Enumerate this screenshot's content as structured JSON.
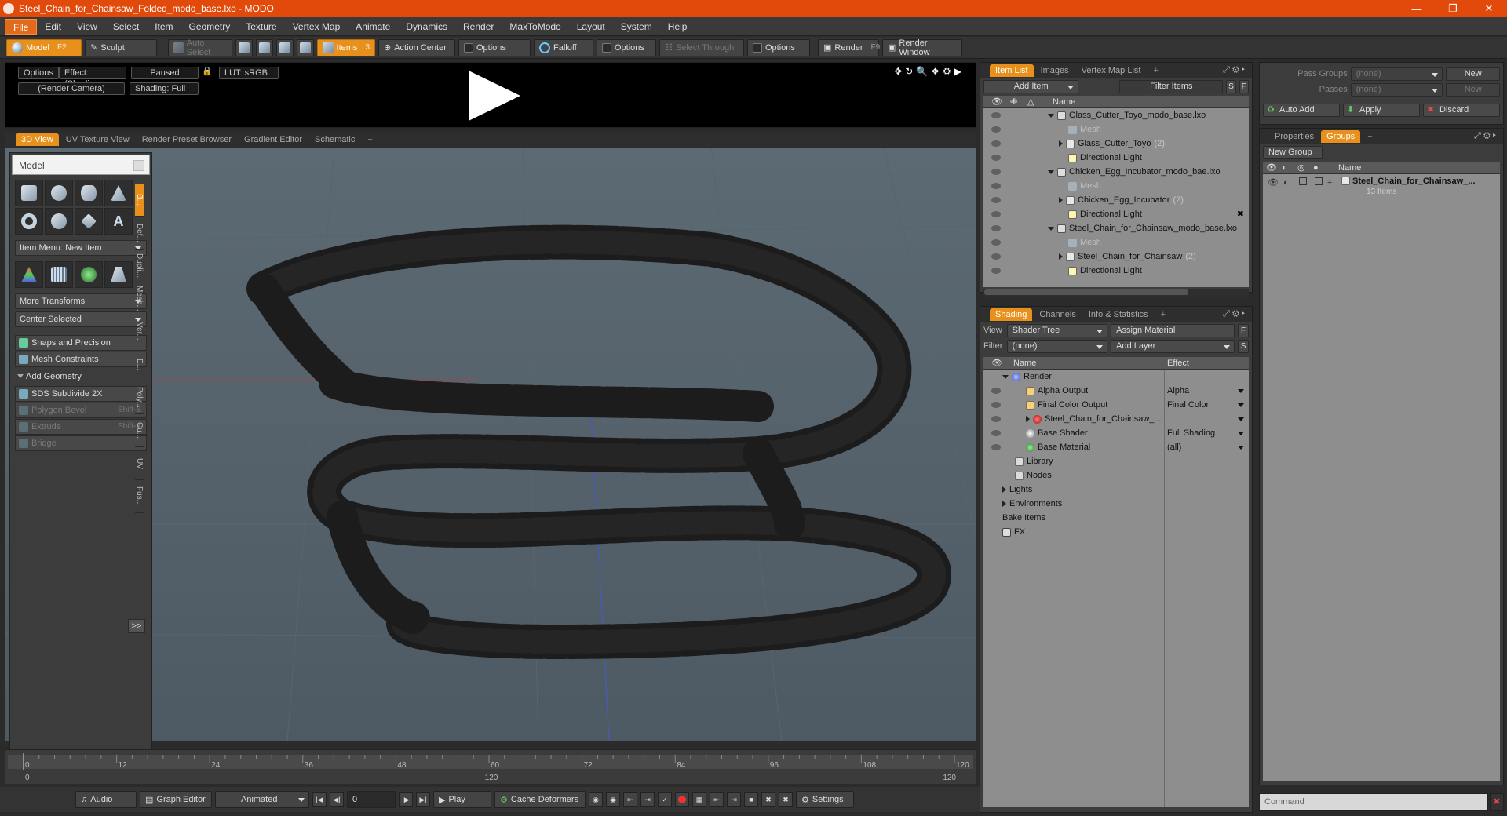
{
  "window": {
    "title": "Steel_Chain_for_Chainsaw_Folded_modo_base.lxo - MODO"
  },
  "menu": [
    "File",
    "Edit",
    "View",
    "Select",
    "Item",
    "Geometry",
    "Texture",
    "Vertex Map",
    "Animate",
    "Dynamics",
    "Render",
    "MaxToModo",
    "Layout",
    "System",
    "Help"
  ],
  "toolbar": {
    "model": "Model",
    "model_key": "F2",
    "sculpt": "Sculpt",
    "auto_select": "Auto Select",
    "items": "Items",
    "items_key": "3",
    "action_center": "Action Center",
    "options1": "Options",
    "falloff": "Falloff",
    "options2": "Options",
    "select_through": "Select Through",
    "options3": "Options",
    "render": "Render",
    "render_key": "F9",
    "render_window": "Render Window"
  },
  "preview": {
    "options": "Options",
    "effect": "Effect: (Shadi...",
    "paused": "Paused",
    "lut": "LUT: sRGB",
    "camera": "(Render Camera)",
    "shading": "Shading: Full"
  },
  "viewport_tabs": [
    "3D View",
    "UV Texture View",
    "Render Preset Browser",
    "Gradient Editor",
    "Schematic"
  ],
  "toolpanel": {
    "title": "Model",
    "item_menu": "Item Menu: New Item",
    "more_transforms": "More Transforms",
    "center_selected": "Center Selected",
    "snaps": "Snaps and Precision",
    "mesh_constraints": "Mesh Constraints",
    "add_geometry": "Add Geometry",
    "sds": "SDS Subdivide 2X",
    "polygon_bevel": "Polygon Bevel",
    "polygon_bevel_key": "Shift-B",
    "extrude": "Extrude",
    "extrude_key": "Shift-X",
    "bridge": "Bridge",
    "more": ">>",
    "side_tabs": [
      "B...",
      "Def...",
      "Dupli...",
      "Mesh...",
      "Ver...",
      "E...",
      "Poly...",
      "Cu...",
      "UV",
      "Fus..."
    ]
  },
  "timeline": {
    "ticks": [
      "0",
      "12",
      "24",
      "36",
      "48",
      "60",
      "72",
      "84",
      "96",
      "108",
      "120"
    ],
    "end_low": "120",
    "end_right": "120",
    "start": "0"
  },
  "bottombar": {
    "audio": "Audio",
    "graph_editor": "Graph Editor",
    "animated": "Animated",
    "frame": "0",
    "play": "Play",
    "cache_deformers": "Cache Deformers",
    "settings": "Settings"
  },
  "item_list": {
    "tabs": [
      "Item List",
      "Images",
      "Vertex Map List"
    ],
    "add_item": "Add Item",
    "filter_items": "Filter Items",
    "s": "S",
    "f": "F",
    "col_name": "Name",
    "rows": [
      {
        "label": "Glass_Cutter_Toyo_modo_base.lxo",
        "kind": "scene",
        "indent": 0
      },
      {
        "label": "Mesh",
        "kind": "mesh",
        "indent": 1
      },
      {
        "label": "Glass_Cutter_Toyo",
        "count": "(2)",
        "kind": "grp",
        "indent": 1
      },
      {
        "label": "Directional Light",
        "kind": "light",
        "indent": 1
      },
      {
        "label": "Chicken_Egg_Incubator_modo_bae.lxo",
        "kind": "scene",
        "indent": 0
      },
      {
        "label": "Mesh",
        "kind": "mesh",
        "indent": 1
      },
      {
        "label": "Chicken_Egg_Incubator",
        "count": "(2)",
        "kind": "grp",
        "indent": 1
      },
      {
        "label": "Directional Light",
        "kind": "light",
        "indent": 1
      },
      {
        "label": "Steel_Chain_for_Chainsaw_modo_base.lxo",
        "kind": "scene",
        "indent": 0
      },
      {
        "label": "Mesh",
        "kind": "mesh",
        "indent": 1
      },
      {
        "label": "Steel_Chain_for_Chainsaw",
        "count": "(2)",
        "kind": "grp",
        "indent": 1
      },
      {
        "label": "Directional Light",
        "kind": "light",
        "indent": 1
      }
    ]
  },
  "shading": {
    "tabs": [
      "Shading",
      "Channels",
      "Info & Statistics"
    ],
    "view_label": "View",
    "view_value": "Shader Tree",
    "assign_material": "Assign Material",
    "filter_label": "Filter",
    "filter_value": "(none)",
    "add_layer": "Add Layer",
    "col_name": "Name",
    "col_effect": "Effect",
    "rows": [
      {
        "label": "Render",
        "effect": "",
        "kind": "rend"
      },
      {
        "label": "Alpha Output",
        "effect": "Alpha",
        "kind": "out"
      },
      {
        "label": "Final Color Output",
        "effect": "Final Color",
        "kind": "out"
      },
      {
        "label": "Steel_Chain_for_Chainsaw_...",
        "effect": "",
        "kind": "mat"
      },
      {
        "label": "Base Shader",
        "effect": "Full Shading",
        "kind": "shd"
      },
      {
        "label": "Base Material",
        "effect": "(all)",
        "kind": "bmat"
      },
      {
        "label": "Library",
        "effect": "",
        "kind": "fold"
      },
      {
        "label": "Nodes",
        "effect": "",
        "kind": "fold"
      },
      {
        "label": "Lights",
        "effect": "",
        "kind": "none"
      },
      {
        "label": "Environments",
        "effect": "",
        "kind": "none"
      },
      {
        "label": "Bake Items",
        "effect": "",
        "kind": "none"
      },
      {
        "label": "FX",
        "effect": "",
        "kind": "fx"
      }
    ]
  },
  "passes": {
    "pass_groups": "Pass Groups",
    "passes": "Passes",
    "none1": "(none)",
    "none2": "(none)",
    "new1": "New",
    "new2": "New",
    "auto_add": "Auto Add",
    "apply": "Apply",
    "discard": "Discard"
  },
  "groups": {
    "tabs": [
      "Properties",
      "Groups"
    ],
    "new_group": "New Group",
    "col_name": "Name",
    "item": "Steel_Chain_for_Chainsaw_...",
    "sub": "13 Items"
  },
  "command": {
    "placeholder": "Command"
  }
}
